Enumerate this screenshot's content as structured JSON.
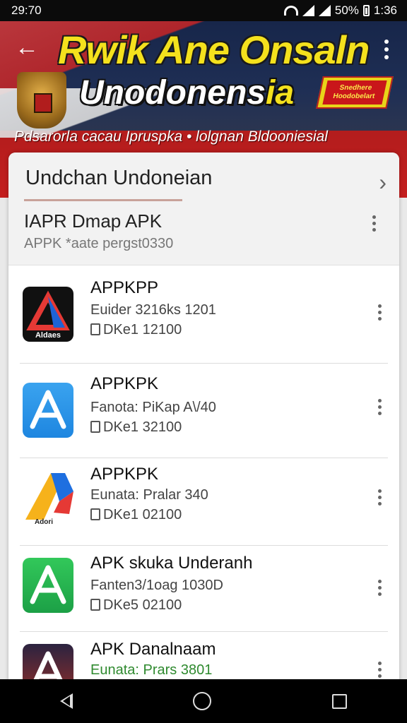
{
  "status_bar": {
    "time": "29:70",
    "battery": "50%",
    "clock_right": "1:36"
  },
  "banner": {
    "title_line1": "Rwik Ane Onsaln",
    "title_line2_main": "Unodonens",
    "title_line2_accent": "ia",
    "promo_line1": "Snedhere",
    "promo_line2": "Hoodobelart",
    "subtitle": "Pdsarorla cacau Ipruspka  •  lolgnan Bldooniesial"
  },
  "card": {
    "section_title": "Undchan Undoneian",
    "header_item": {
      "title": "IAPR Dmap APK",
      "meta": "APPK  *aate pergst0330"
    }
  },
  "apps": [
    {
      "name": "APPKPP",
      "meta": "Euider 3216ks 1201",
      "size": "DKe1 12100",
      "icon": "dark-triangle-icon",
      "icon_label": "Aldaes"
    },
    {
      "name": "APPKPK",
      "meta": "Fanota: PiKap A\\/40",
      "size": "DKe1 32100",
      "icon": "blue-a-icon"
    },
    {
      "name": "APPKPK",
      "meta": "Eunata: Pralar 340",
      "size": "DKe1 02100",
      "icon": "multicolor-a-icon",
      "icon_label": "Adori"
    },
    {
      "name": "APK skuka Underanh",
      "meta": "Fanten3/1oag 1030D",
      "size": "DKe5 02100",
      "icon": "green-a-icon"
    },
    {
      "name": "APK Danalnaam",
      "meta": "Eunata: Prars 3801",
      "size": "",
      "icon": "photo-a-icon",
      "meta_color": "#2f8a2f"
    }
  ]
}
